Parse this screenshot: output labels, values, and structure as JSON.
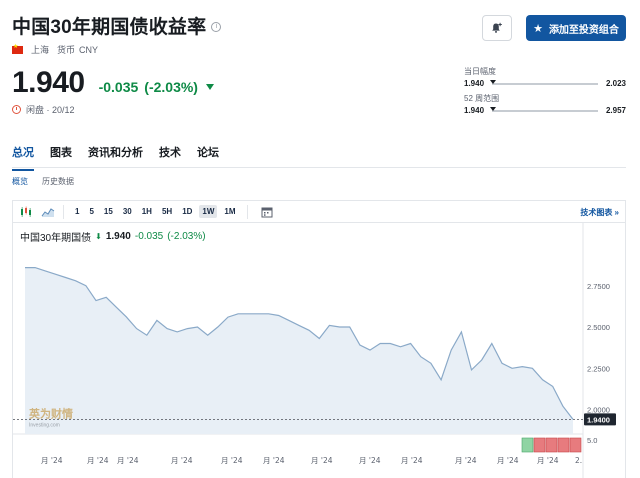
{
  "header": {
    "title": "中国30年期国债收益率",
    "location": "上海",
    "currency_label": "货币",
    "currency": "CNY",
    "price": "1.940",
    "change": "-0.035",
    "change_pct": "(-2.03%)",
    "close_status": "闲盘 · 20/12",
    "add_button_label": "添加至投资组合"
  },
  "ranges": {
    "day": {
      "label": "当日幅度",
      "low": "1.940",
      "high": "2.023",
      "position": 0.0
    },
    "week52": {
      "label": "52 周范围",
      "low": "1.940",
      "high": "2.957",
      "position": 0.0
    }
  },
  "tabs": [
    {
      "label": "总况",
      "active": true
    },
    {
      "label": "图表",
      "active": false
    },
    {
      "label": "资讯和分析",
      "active": false
    },
    {
      "label": "技术",
      "active": false
    },
    {
      "label": "论坛",
      "active": false
    }
  ],
  "subtabs": [
    {
      "label": "概览",
      "active": true
    },
    {
      "label": "历史数据",
      "active": false
    }
  ],
  "toolbar": {
    "intervals": [
      "1",
      "5",
      "15",
      "30",
      "1H",
      "5H",
      "1D",
      "1W",
      "1M"
    ],
    "active_interval": "1W",
    "tech_chart_link": "技术图表 »"
  },
  "legend": {
    "name": "中国30年期国债",
    "value": "1.940",
    "change": "-0.035",
    "change_pct": "(-2.03%)"
  },
  "chart_data": {
    "type": "area",
    "y_ticks": [
      "2.7500",
      "2.5000",
      "2.2500",
      "2.0000"
    ],
    "last_value_label": "1.9400",
    "volume_tick": "5.0",
    "x_tick_labels": [
      "月 '24",
      "月 '24",
      "月 '24",
      "月 '24",
      "月 '24",
      "月 '24",
      "月 '24",
      "月 '24",
      "月 '24",
      "月 '24",
      "月 '24",
      "月 '24",
      "2."
    ],
    "ylim": [
      1.9,
      2.9
    ],
    "values": [
      2.86,
      2.86,
      2.84,
      2.82,
      2.8,
      2.78,
      2.75,
      2.66,
      2.68,
      2.62,
      2.56,
      2.49,
      2.45,
      2.54,
      2.49,
      2.47,
      2.49,
      2.5,
      2.45,
      2.5,
      2.56,
      2.58,
      2.58,
      2.58,
      2.58,
      2.57,
      2.54,
      2.51,
      2.48,
      2.43,
      2.51,
      2.5,
      2.5,
      2.39,
      2.36,
      2.4,
      2.4,
      2.38,
      2.4,
      2.32,
      2.28,
      2.18,
      2.36,
      2.47,
      2.24,
      2.3,
      2.4,
      2.28,
      2.25,
      2.26,
      2.25,
      2.18,
      2.14,
      2.02,
      1.94
    ],
    "volume_bars": [
      {
        "color": "green"
      },
      {
        "color": "red"
      },
      {
        "color": "red"
      },
      {
        "color": "red"
      },
      {
        "color": "red"
      }
    ],
    "colors": {
      "line": "#8aa9c8",
      "fill": "#e8eff6",
      "volume_green": "#8fd4a3",
      "volume_red": "#e77b7e"
    },
    "grid": false
  }
}
